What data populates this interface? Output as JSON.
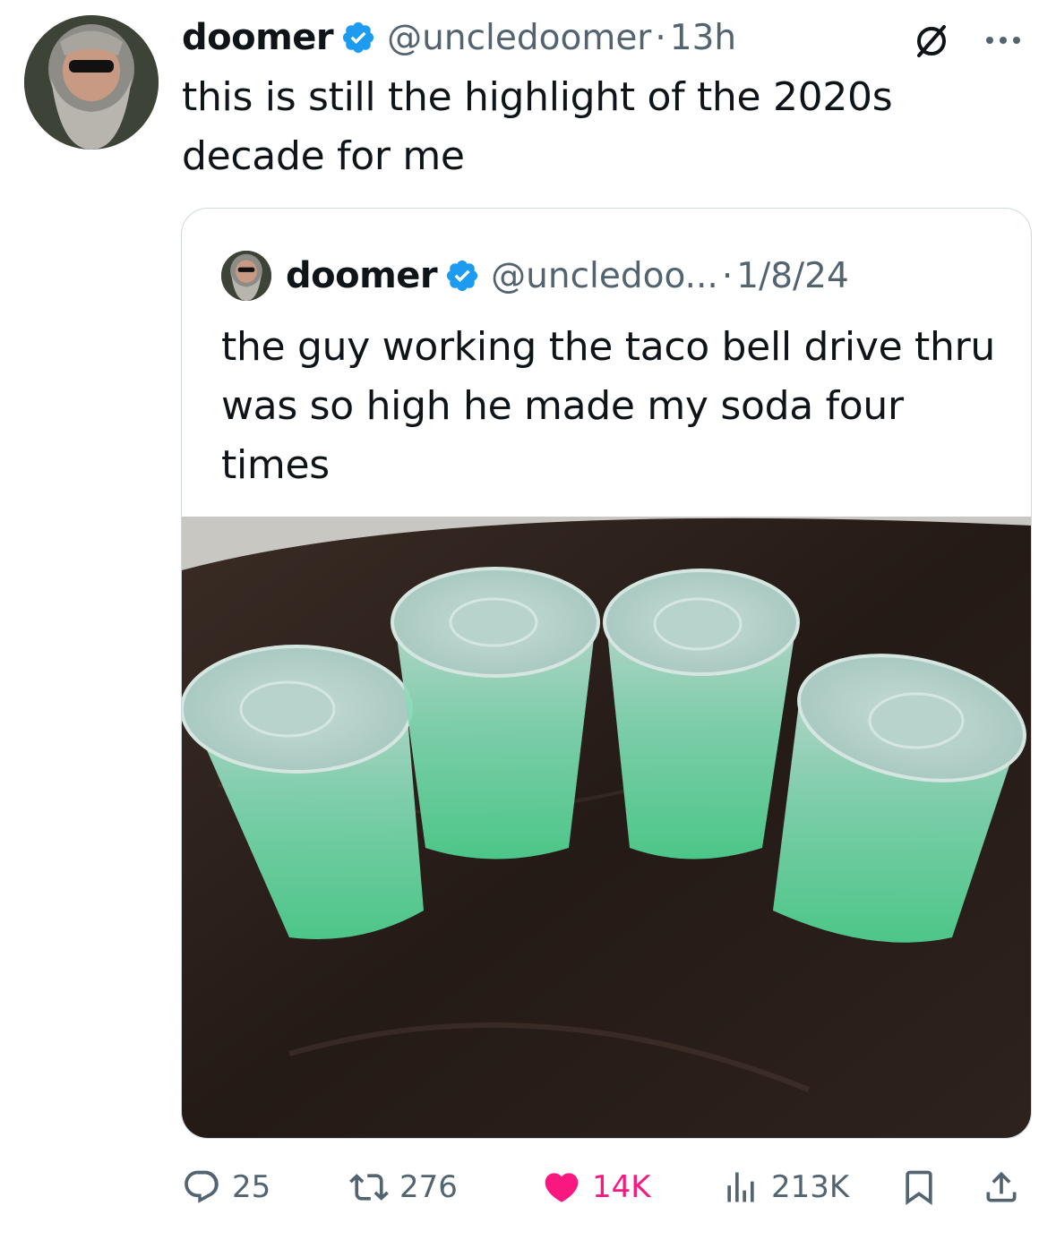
{
  "tweet": {
    "author": {
      "name": "doomer",
      "handle": "@uncledoomer",
      "avatar": "avatar-icon"
    },
    "time_sep": "·",
    "time": "13h",
    "text": "this is still the highlight of the 2020s decade for me"
  },
  "quoted": {
    "author": {
      "name": "doomer",
      "handle": "@uncledoo...",
      "avatar": "avatar-icon"
    },
    "date_sep": "·",
    "date": "1/8/24",
    "text": "the guy working the taco bell drive thru was so high he made my soda four times",
    "media": {
      "description_icon": "photo-four-green-soda-cups"
    }
  },
  "actions": {
    "replies": "25",
    "retweets": "276",
    "likes": "14K",
    "views": "213K"
  },
  "colors": {
    "verified": "#1d9bf0",
    "secondary_text": "#536471",
    "like": "#f91880",
    "border": "#cfd9de"
  }
}
